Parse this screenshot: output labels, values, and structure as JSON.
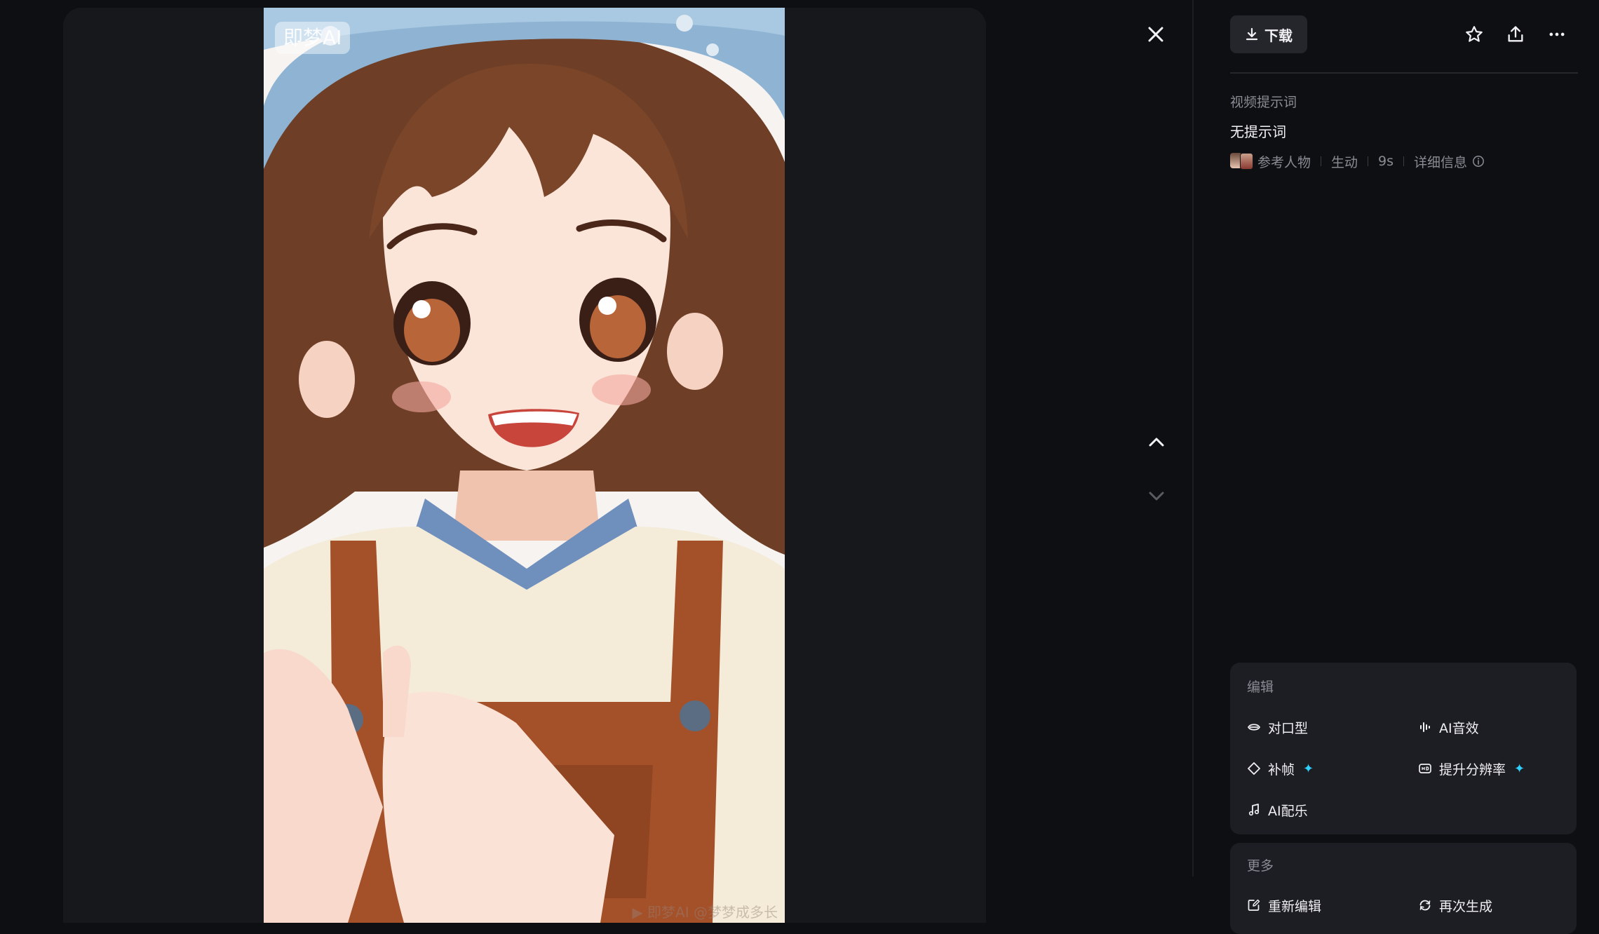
{
  "viewer": {
    "watermark_top": "即梦AI",
    "watermark_bottom": "▶ 即梦AI @梦梦成多长"
  },
  "nav": {
    "close_icon": "close-icon",
    "prev_icon": "chevron-up-icon",
    "next_icon": "chevron-down-icon"
  },
  "toolbar": {
    "download_label": "下载",
    "icons": [
      "star-icon",
      "share-icon",
      "more-icon"
    ]
  },
  "prompt": {
    "title": "视频提示词",
    "value": "无提示词"
  },
  "meta": {
    "reference": "参考人物",
    "style": "生动",
    "duration": "9s",
    "details": "详细信息"
  },
  "edit_card": {
    "title": "编辑",
    "actions": [
      {
        "label": "对口型",
        "icon": "lip-sync-icon"
      },
      {
        "label": "AI音效",
        "icon": "audio-wave-icon"
      },
      {
        "label": "补帧",
        "icon": "frame-icon"
      },
      {
        "label": "提升分辨率",
        "icon": "hd-icon"
      },
      {
        "label": "AI配乐",
        "icon": "music-note-icon"
      }
    ]
  },
  "more_card": {
    "title": "更多",
    "actions": [
      {
        "label": "重新编辑",
        "icon": "edit-icon"
      },
      {
        "label": "再次生成",
        "icon": "regenerate-icon"
      }
    ]
  },
  "colors": {
    "background": "#0e0f12",
    "panel": "#17181c",
    "card": "#1d1e23",
    "accent_sparkle": "#2fd2ff"
  }
}
